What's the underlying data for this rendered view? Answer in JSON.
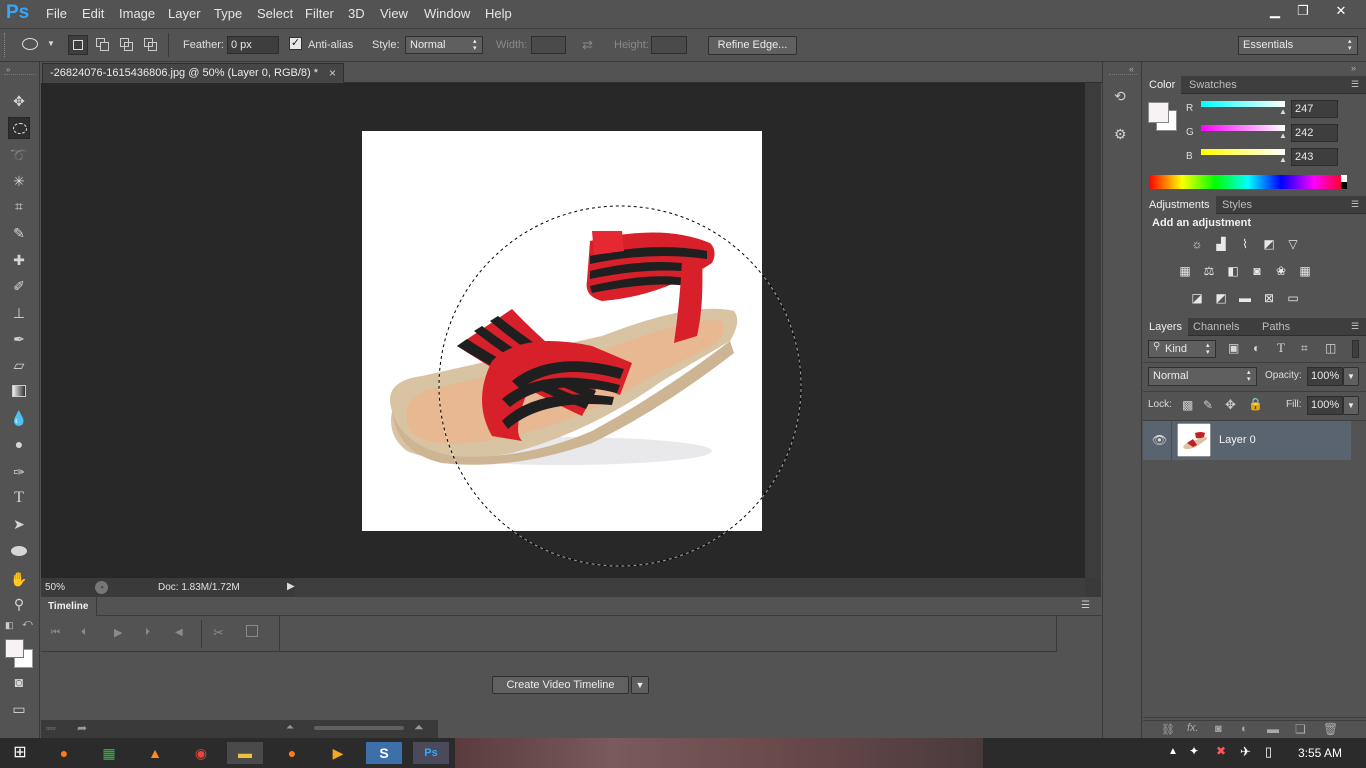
{
  "app": {
    "logo": "Ps"
  },
  "menu": [
    "File",
    "Edit",
    "Image",
    "Layer",
    "Type",
    "Select",
    "Filter",
    "3D",
    "View",
    "Window",
    "Help"
  ],
  "window_controls": {
    "minimize": "▁",
    "restore": "❐",
    "close": "✕"
  },
  "options": {
    "feather_label": "Feather:",
    "feather_value": "0 px",
    "antialias_label": "Anti-alias",
    "style_label": "Style:",
    "style_value": "Normal",
    "width_label": "Width:",
    "height_label": "Height:",
    "refine_edge": "Refine Edge...",
    "workspace": "Essentials"
  },
  "document": {
    "tab_title": "-26824076-1615436806.jpg @ 50% (Layer 0, RGB/8) *",
    "close": "×",
    "zoom": "50%",
    "doc_info": "Doc: 1.83M/1.72M"
  },
  "timeline": {
    "title": "Timeline",
    "create_button": "Create Video Timeline"
  },
  "color_panel": {
    "tabs": [
      "Color",
      "Swatches"
    ],
    "r_label": "R",
    "g_label": "G",
    "b_label": "B",
    "r": "247",
    "g": "242",
    "b": "243",
    "foreground": "#f7f2f3"
  },
  "adjustments_panel": {
    "tabs": [
      "Adjustments",
      "Styles"
    ],
    "heading": "Add an adjustment"
  },
  "layers_panel": {
    "tabs": [
      "Layers",
      "Channels",
      "Paths"
    ],
    "kind": "Kind",
    "blend_mode": "Normal",
    "opacity_label": "Opacity:",
    "opacity": "100%",
    "lock_label": "Lock:",
    "fill_label": "Fill:",
    "fill": "100%",
    "layers": [
      {
        "name": "Layer 0"
      }
    ]
  },
  "taskbar": {
    "time": "3:55 AM"
  },
  "colors": {
    "ui_bg": "#535353",
    "canvas_bg": "#282828",
    "ps_blue": "#31a8ff",
    "selected_layer": "#5a6370"
  }
}
